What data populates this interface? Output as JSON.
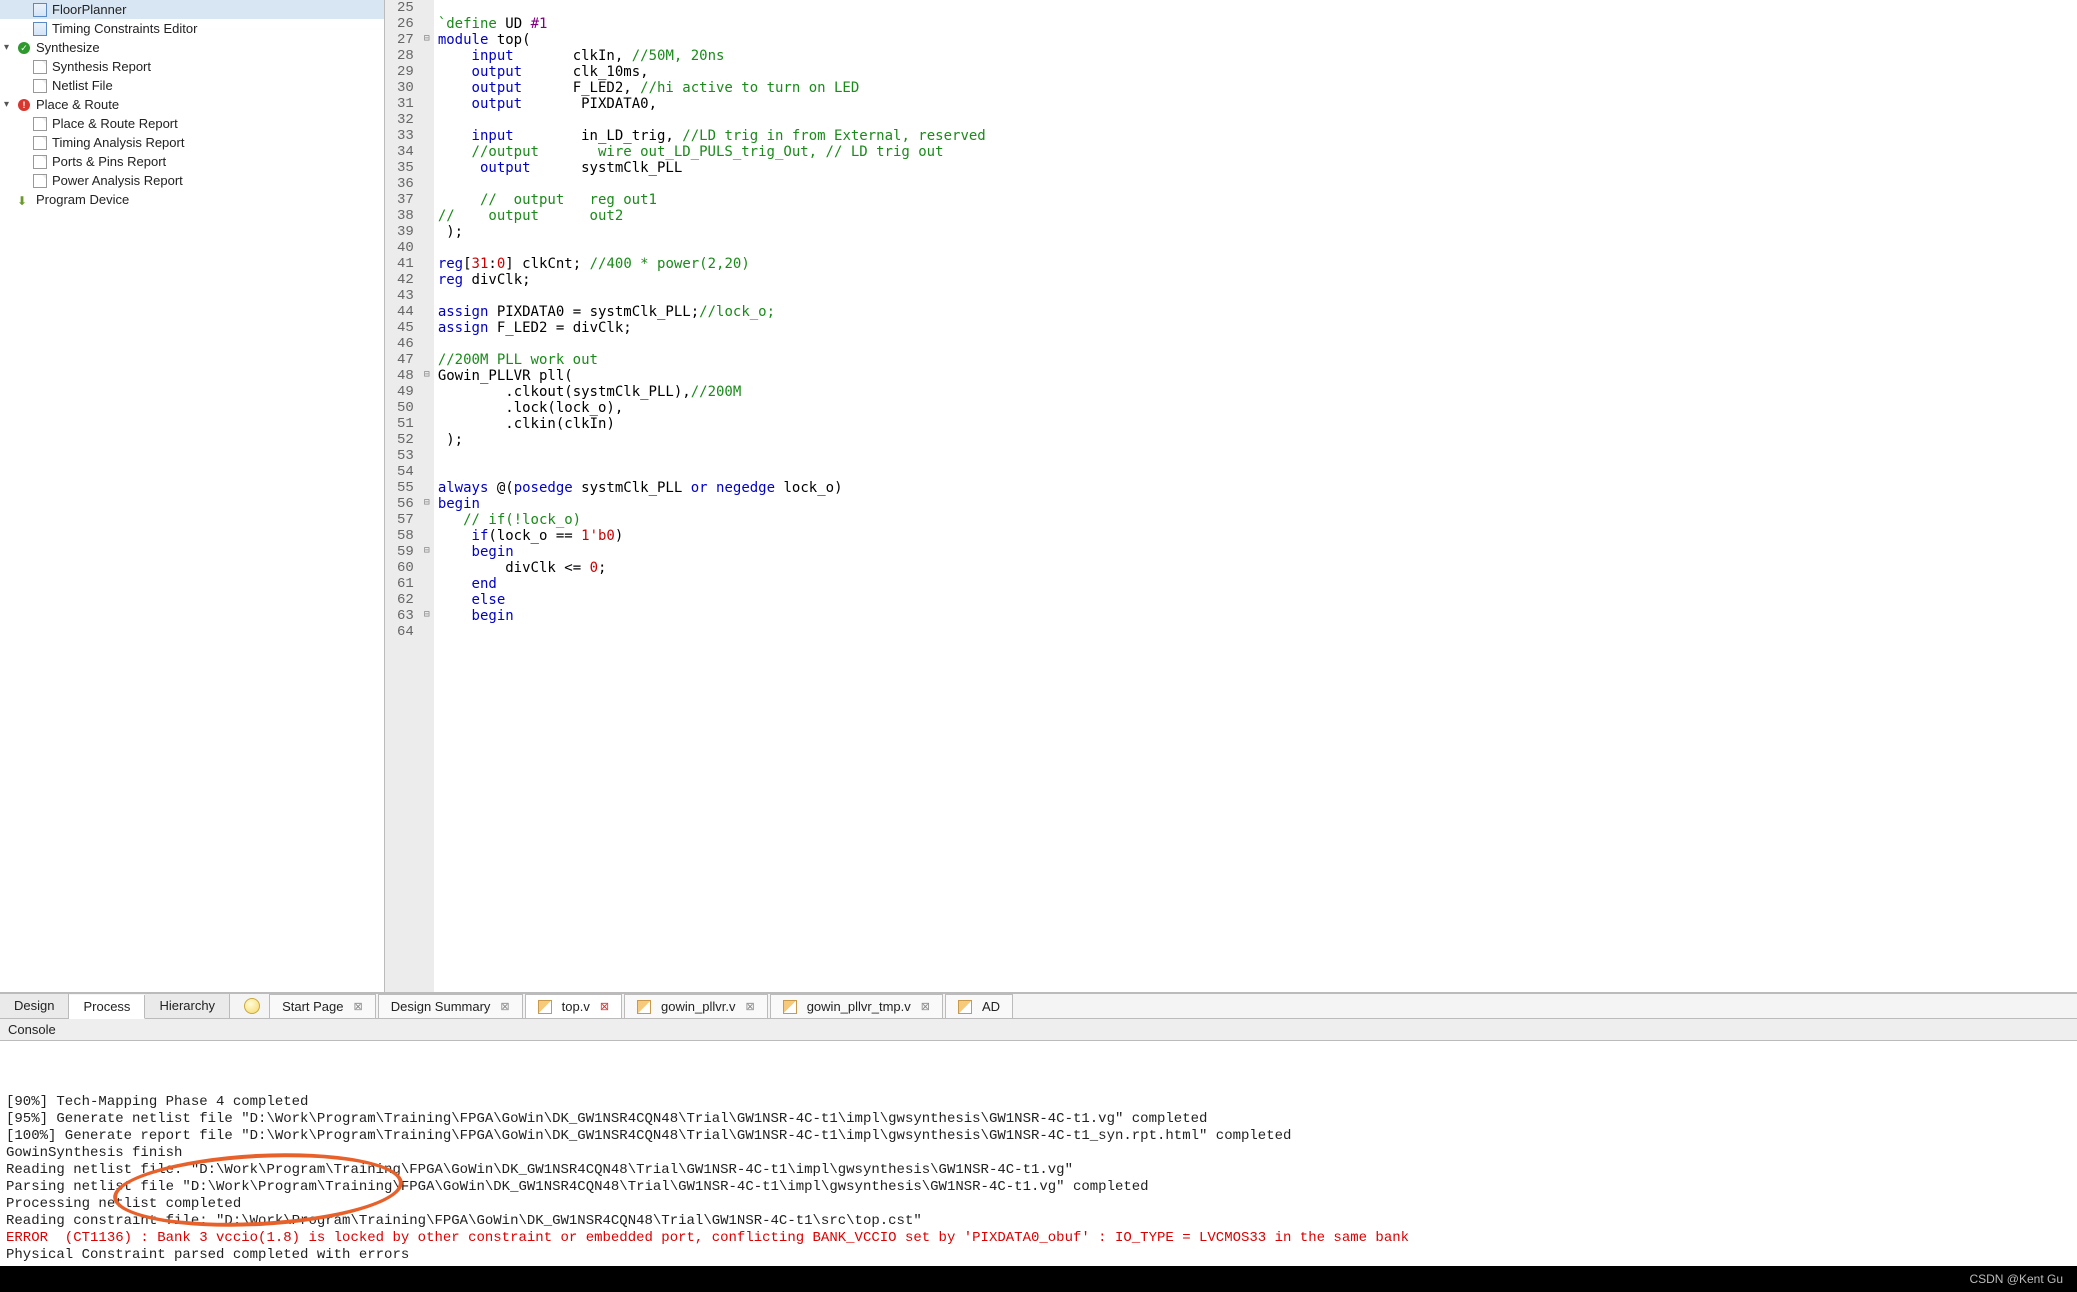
{
  "sidebar": {
    "items": [
      {
        "label": "FloorPlanner",
        "indent": 28,
        "icon": "file-blue",
        "selected": true
      },
      {
        "label": "Timing Constraints Editor",
        "indent": 28,
        "icon": "file-blue"
      },
      {
        "label": "Synthesize",
        "indent": 0,
        "chevron": "▾",
        "status": "ok"
      },
      {
        "label": "Synthesis Report",
        "indent": 28,
        "icon": "file"
      },
      {
        "label": "Netlist File",
        "indent": 28,
        "icon": "file"
      },
      {
        "label": "Place & Route",
        "indent": 0,
        "chevron": "▾",
        "status": "err"
      },
      {
        "label": "Place & Route Report",
        "indent": 28,
        "icon": "file"
      },
      {
        "label": "Timing Analysis Report",
        "indent": 28,
        "icon": "file"
      },
      {
        "label": "Ports & Pins Report",
        "indent": 28,
        "icon": "file"
      },
      {
        "label": "Power Analysis Report",
        "indent": 28,
        "icon": "file"
      },
      {
        "label": "Program Device",
        "indent": 12,
        "icon": "prog"
      }
    ]
  },
  "code": {
    "first_line": 25,
    "lines": [
      {
        "n": 25,
        "fold": "",
        "html": ""
      },
      {
        "n": 26,
        "fold": "",
        "html": "<span class='macro'>`define</span> <span class='ident'>UD</span> <span class='lit'>#1</span>"
      },
      {
        "n": 27,
        "fold": "⊟",
        "html": "<span class='kw'>module</span> <span class='ident'>top</span><span class='plain'>(</span>"
      },
      {
        "n": 28,
        "fold": "",
        "html": "    <span class='kw'>input</span>       <span class='ident'>clkIn</span><span class='plain'>,</span> <span class='cmt'>//50M, 20ns</span>"
      },
      {
        "n": 29,
        "fold": "",
        "html": "    <span class='kw'>output</span>      <span class='ident'>clk_10ms</span><span class='plain'>,</span>"
      },
      {
        "n": 30,
        "fold": "",
        "html": "    <span class='kw'>output</span>      <span class='ident'>F_LED2</span><span class='plain'>,</span> <span class='cmt'>//hi active to turn on LED</span>"
      },
      {
        "n": 31,
        "fold": "",
        "html": "    <span class='kw'>output</span>       <span class='ident'>PIXDATA0</span><span class='plain'>,</span>"
      },
      {
        "n": 32,
        "fold": "",
        "html": ""
      },
      {
        "n": 33,
        "fold": "",
        "html": "    <span class='kw'>input</span>        <span class='ident'>in_LD_trig</span><span class='plain'>,</span> <span class='cmt'>//LD trig in from External, reserved</span>"
      },
      {
        "n": 34,
        "fold": "",
        "html": "    <span class='cmt'>//output       wire out_LD_PULS_trig_Out, // LD trig out</span>"
      },
      {
        "n": 35,
        "fold": "",
        "html": "     <span class='kw'>output</span>      <span class='ident'>systmClk_PLL</span>"
      },
      {
        "n": 36,
        "fold": "",
        "html": ""
      },
      {
        "n": 37,
        "fold": "",
        "html": "     <span class='cmt'>//  output   reg out1</span>"
      },
      {
        "n": 38,
        "fold": "",
        "html": "<span class='cmt'>//    output      out2</span>"
      },
      {
        "n": 39,
        "fold": "",
        "html": " <span class='plain'>);</span>"
      },
      {
        "n": 40,
        "fold": "",
        "html": ""
      },
      {
        "n": 41,
        "fold": "",
        "html": "<span class='kw'>reg</span><span class='plain'>[</span><span class='num'>31</span><span class='plain'>:</span><span class='num'>0</span><span class='plain'>]</span> <span class='ident'>clkCnt</span><span class='plain'>;</span> <span class='cmt'>//400 * power(2,20)</span>"
      },
      {
        "n": 42,
        "fold": "",
        "html": "<span class='kw'>reg</span> <span class='ident'>divClk</span><span class='plain'>;</span>"
      },
      {
        "n": 43,
        "fold": "",
        "html": ""
      },
      {
        "n": 44,
        "fold": "",
        "html": "<span class='kw'>assign</span> <span class='ident'>PIXDATA0</span> <span class='plain'>=</span> <span class='ident'>systmClk_PLL</span><span class='plain'>;</span><span class='cmt'>//lock_o;</span>"
      },
      {
        "n": 45,
        "fold": "",
        "html": "<span class='kw'>assign</span> <span class='ident'>F_LED2</span> <span class='plain'>=</span> <span class='ident'>divClk</span><span class='plain'>;</span>"
      },
      {
        "n": 46,
        "fold": "",
        "html": ""
      },
      {
        "n": 47,
        "fold": "",
        "html": "<span class='cmt'>//200M PLL work out</span>"
      },
      {
        "n": 48,
        "fold": "⊟",
        "html": "<span class='ident'>Gowin_PLLVR pll</span><span class='plain'>(</span>"
      },
      {
        "n": 49,
        "fold": "",
        "html": "        <span class='plain'>.</span><span class='ident'>clkout</span><span class='plain'>(</span><span class='ident'>systmClk_PLL</span><span class='plain'>),</span><span class='cmt'>//200M</span>"
      },
      {
        "n": 50,
        "fold": "",
        "html": "        <span class='plain'>.</span><span class='ident'>lock</span><span class='plain'>(</span><span class='ident'>lock_o</span><span class='plain'>),</span>"
      },
      {
        "n": 51,
        "fold": "",
        "html": "        <span class='plain'>.</span><span class='ident'>clkin</span><span class='plain'>(</span><span class='ident'>clkIn</span><span class='plain'>)</span>"
      },
      {
        "n": 52,
        "fold": "",
        "html": " <span class='plain'>);</span>"
      },
      {
        "n": 53,
        "fold": "",
        "html": ""
      },
      {
        "n": 54,
        "fold": "",
        "html": ""
      },
      {
        "n": 55,
        "fold": "",
        "html": "<span class='kw'>always</span> <span class='plain'>@(</span><span class='kw'>posedge</span> <span class='ident'>systmClk_PLL</span> <span class='kw'>or</span> <span class='kw'>negedge</span> <span class='ident'>lock_o</span><span class='plain'>)</span>"
      },
      {
        "n": 56,
        "fold": "⊟",
        "html": "<span class='kw'>begin</span>"
      },
      {
        "n": 57,
        "fold": "",
        "html": "   <span class='cmt'>// if(!lock_o)</span>"
      },
      {
        "n": 58,
        "fold": "",
        "html": "    <span class='kw'>if</span><span class='plain'>(</span><span class='ident'>lock_o</span> <span class='plain'>==</span> <span class='num'>1'b0</span><span class='plain'>)</span>"
      },
      {
        "n": 59,
        "fold": "⊟",
        "html": "    <span class='kw'>begin</span>"
      },
      {
        "n": 60,
        "fold": "",
        "html": "        <span class='ident'>divClk</span> <span class='plain'>&lt;=</span> <span class='num'>0</span><span class='plain'>;</span>"
      },
      {
        "n": 61,
        "fold": "",
        "html": "    <span class='kw'>end</span>"
      },
      {
        "n": 62,
        "fold": "",
        "html": "    <span class='kw'>else</span>"
      },
      {
        "n": 63,
        "fold": "⊟",
        "html": "    <span class='kw'>begin</span>"
      },
      {
        "n": 64,
        "fold": "",
        "html": "        <span class='ident'></span>"
      }
    ]
  },
  "view_tabs": {
    "items": [
      "Design",
      "Process",
      "Hierarchy"
    ],
    "active": 1
  },
  "file_tabs": {
    "items": [
      {
        "label": "Start Page",
        "icon": "",
        "close": "normal"
      },
      {
        "label": "Design Summary",
        "icon": "",
        "close": "normal"
      },
      {
        "label": "top.v",
        "icon": "edit",
        "close": "dirty",
        "active": true
      },
      {
        "label": "gowin_pllvr.v",
        "icon": "edit",
        "close": "normal"
      },
      {
        "label": "gowin_pllvr_tmp.v",
        "icon": "edit",
        "close": "normal"
      },
      {
        "label": "AD",
        "icon": "edit",
        "close": ""
      }
    ]
  },
  "console": {
    "title": "Console",
    "lines": [
      {
        "cls": "",
        "t": "[90%] Tech-Mapping Phase 4 completed"
      },
      {
        "cls": "",
        "t": "[95%] Generate netlist file \"D:\\Work\\Program\\Training\\FPGA\\GoWin\\DK_GW1NSR4CQN48\\Trial\\GW1NSR-4C-t1\\impl\\gwsynthesis\\GW1NSR-4C-t1.vg\" completed"
      },
      {
        "cls": "",
        "t": "[100%] Generate report file \"D:\\Work\\Program\\Training\\FPGA\\GoWin\\DK_GW1NSR4CQN48\\Trial\\GW1NSR-4C-t1\\impl\\gwsynthesis\\GW1NSR-4C-t1_syn.rpt.html\" completed"
      },
      {
        "cls": "",
        "t": "GowinSynthesis finish"
      },
      {
        "cls": "",
        "t": "Reading netlist file: \"D:\\Work\\Program\\Training\\FPGA\\GoWin\\DK_GW1NSR4CQN48\\Trial\\GW1NSR-4C-t1\\impl\\gwsynthesis\\GW1NSR-4C-t1.vg\""
      },
      {
        "cls": "",
        "t": "Parsing netlist file \"D:\\Work\\Program\\Training\\FPGA\\GoWin\\DK_GW1NSR4CQN48\\Trial\\GW1NSR-4C-t1\\impl\\gwsynthesis\\GW1NSR-4C-t1.vg\" completed"
      },
      {
        "cls": "",
        "t": "Processing netlist completed"
      },
      {
        "cls": "",
        "t": "Reading constraint file: \"D:\\Work\\Program\\Training\\FPGA\\GoWin\\DK_GW1NSR4CQN48\\Trial\\GW1NSR-4C-t1\\src\\top.cst\""
      },
      {
        "cls": "err-line",
        "t": "ERROR  (CT1136) : Bank 3 vccio(1.8) is locked by other constraint or embedded port, conflicting BANK_VCCIO set by 'PIXDATA0_obuf' : IO_TYPE = LVCMOS33 in the same bank"
      },
      {
        "cls": "",
        "t": "Physical Constraint parsed completed with errors"
      }
    ]
  },
  "footer": {
    "watermark": "CSDN @Kent Gu"
  }
}
